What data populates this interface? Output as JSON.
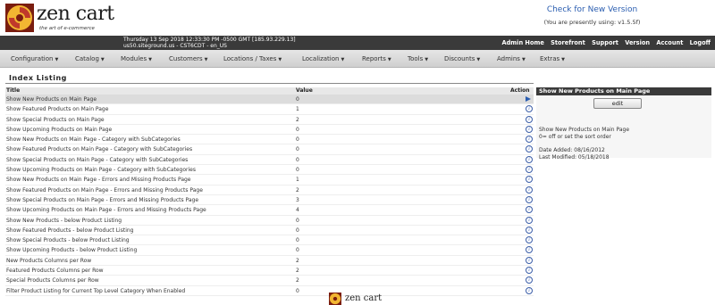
{
  "header": {
    "brand": "zen cart",
    "tagline": "the art of e-commerce",
    "version_link": "Check for New Version",
    "version_current": "(You are presently using: v1.5.5f)"
  },
  "topbar": {
    "datetime_line1": "Thursday 13 Sep 2018 12:33:30 PM -0500 GMT [185.93.229.13]",
    "datetime_line2": "us50.siteground.us - CST6CDT - en_US",
    "links": [
      "Admin Home",
      "Storefront",
      "Support",
      "Version",
      "Account",
      "Logoff"
    ]
  },
  "menu": [
    "Configuration",
    "Catalog",
    "Modules",
    "Customers",
    "Locations / Taxes",
    "Localization",
    "Reports",
    "Tools",
    "Discounts",
    "Admins",
    "Extras"
  ],
  "page": {
    "title": "Index Listing"
  },
  "table": {
    "headers": {
      "title": "Title",
      "value": "Value",
      "action": "Action"
    },
    "rows": [
      {
        "title": "Show New Products on Main Page",
        "value": "0",
        "selected": true
      },
      {
        "title": "Show Featured Products on Main Page",
        "value": "1"
      },
      {
        "title": "Show Special Products on Main Page",
        "value": "2"
      },
      {
        "title": "Show Upcoming Products on Main Page",
        "value": "0"
      },
      {
        "title": "Show New Products on Main Page - Category with SubCategories",
        "value": "0"
      },
      {
        "title": "Show Featured Products on Main Page - Category with SubCategories",
        "value": "0"
      },
      {
        "title": "Show Special Products on Main Page - Category with SubCategories",
        "value": "0"
      },
      {
        "title": "Show Upcoming Products on Main Page - Category with SubCategories",
        "value": "0"
      },
      {
        "title": "Show New Products on Main Page - Errors and Missing Products Page",
        "value": "1"
      },
      {
        "title": "Show Featured Products on Main Page - Errors and Missing Products Page",
        "value": "2"
      },
      {
        "title": "Show Special Products on Main Page - Errors and Missing Products Page",
        "value": "3"
      },
      {
        "title": "Show Upcoming Products on Main Page - Errors and Missing Products Page",
        "value": "4"
      },
      {
        "title": "Show New Products - below Product Listing",
        "value": "0"
      },
      {
        "title": "Show Featured Products - below Product Listing",
        "value": "0"
      },
      {
        "title": "Show Special Products - below Product Listing",
        "value": "0"
      },
      {
        "title": "Show Upcoming Products - below Product Listing",
        "value": "0"
      },
      {
        "title": "New Products Columns per Row",
        "value": "2"
      },
      {
        "title": "Featured Products Columns per Row",
        "value": "2"
      },
      {
        "title": "Special Products Columns per Row",
        "value": "2"
      },
      {
        "title": "Filter Product Listing for Current Top Level Category When Enabled",
        "value": "0"
      }
    ]
  },
  "sidebox": {
    "heading": "Show New Products on Main Page",
    "edit_label": "edit",
    "desc_line1": "Show New Products on Main Page",
    "desc_line2": "0= off or set the sort order",
    "date_added": "Date Added: 08/16/2012",
    "last_modified": "Last Modified: 05/18/2018"
  },
  "footer": {
    "brand": "zen cart"
  },
  "colors": {
    "topbar": "#3a3a3a",
    "link": "#2a5db0",
    "info_icon": "#3a5da8"
  }
}
